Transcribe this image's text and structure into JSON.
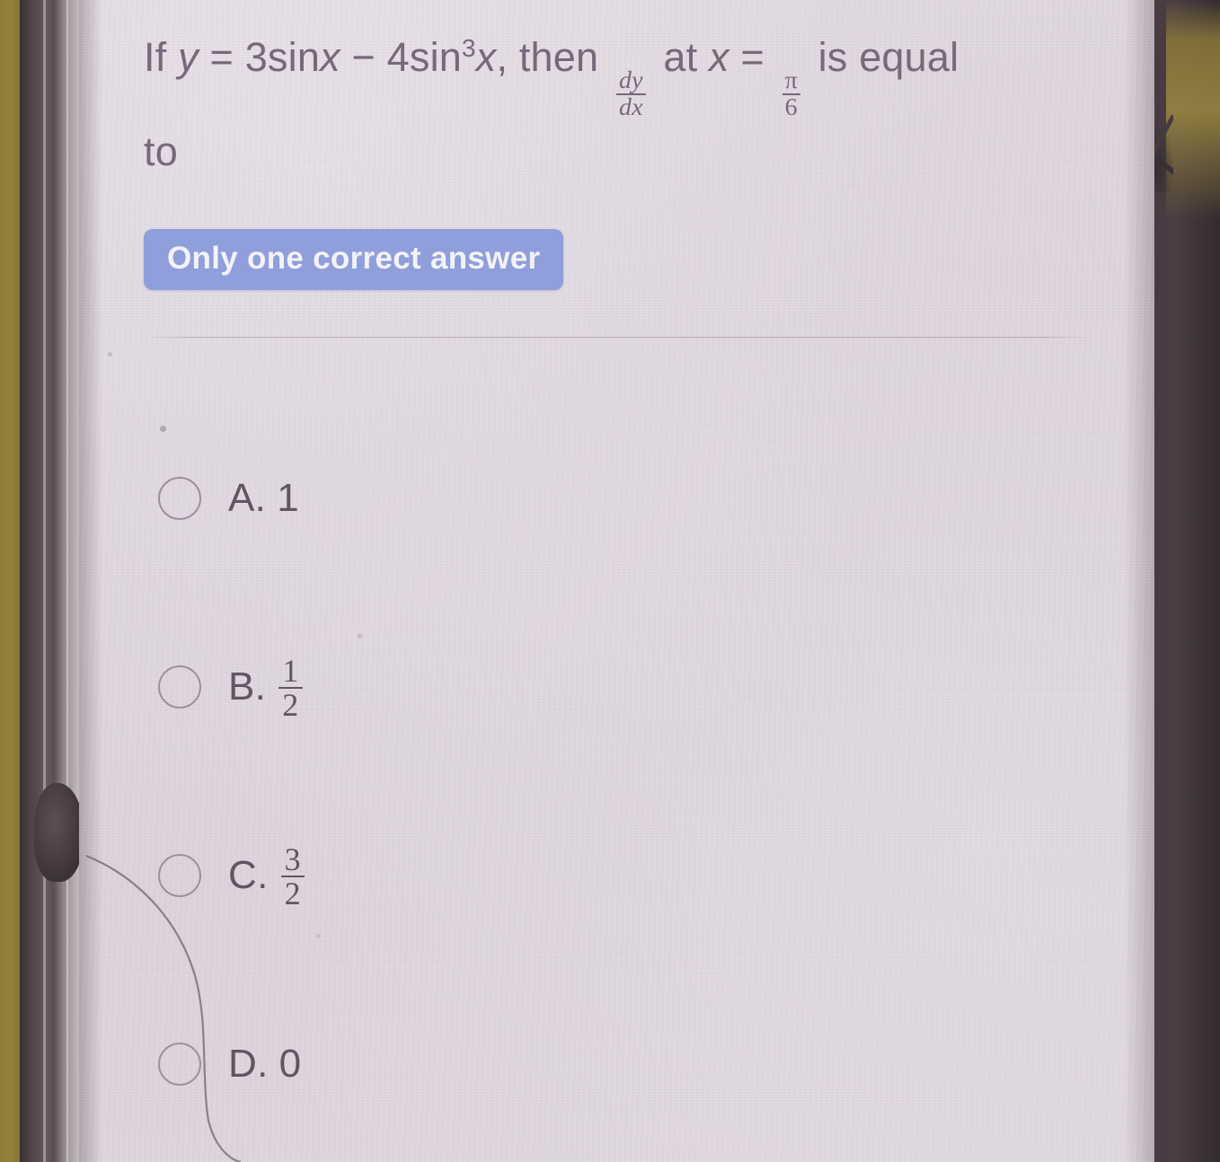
{
  "question": {
    "prefix": "If",
    "lhs_var": "y",
    "equals": "=",
    "expr_part1": "3sin",
    "expr_var1": "x",
    "minus": "−",
    "expr_part2": "4sin",
    "exponent": "3",
    "expr_var2": "x",
    "comma_then": ", then",
    "derivative_num": "dy",
    "derivative_den": "dx",
    "at": "at",
    "at_var": "x",
    "at_equals": "=",
    "value_num": "π",
    "value_den": "6",
    "tail": "is equal",
    "tail_line2": "to",
    "plain_text": "If y = 3sinx − 4sin³x, then dy/dx at x = π/6 is equal to"
  },
  "badge": {
    "label": "Only one correct answer",
    "background_color": "#8f9fdb",
    "text_color": "#f2f2fa"
  },
  "options": [
    {
      "label": "A.",
      "value": "1",
      "is_fraction": false,
      "numerator": "",
      "denominator": "",
      "selected": false
    },
    {
      "label": "B.",
      "value": "",
      "is_fraction": true,
      "numerator": "1",
      "denominator": "2",
      "selected": false
    },
    {
      "label": "C.",
      "value": "",
      "is_fraction": true,
      "numerator": "3",
      "denominator": "2",
      "selected": false
    },
    {
      "label": "D.",
      "value": "0",
      "is_fraction": false,
      "numerator": "",
      "denominator": "",
      "selected": false
    }
  ],
  "colors": {
    "page_background": "#ded5dd",
    "question_text": "#75697a",
    "option_text": "#5f5564",
    "radio_border": "#9c90a0",
    "divider": "#968a96",
    "bezel": "#4c4044",
    "desk": "#8d7c33"
  }
}
